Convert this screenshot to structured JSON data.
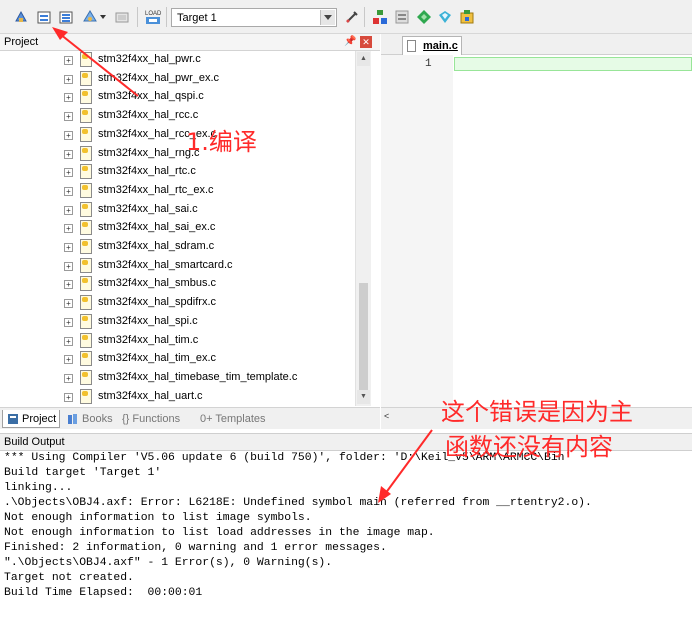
{
  "toolbar": {
    "target_value": "Target 1",
    "icons": [
      "translate-icon",
      "build-icon",
      "rebuild-icon",
      "batch-build-icon",
      "stop-build-icon",
      "download-icon",
      "target-options-icon",
      "manage-components-icon",
      "file-extensions-icon",
      "pack-installer-icon",
      "select-packs-icon"
    ]
  },
  "project_panel": {
    "title": "Project",
    "files": [
      "stm32f4xx_hal_pwr.c",
      "stm32f4xx_hal_pwr_ex.c",
      "stm32f4xx_hal_qspi.c",
      "stm32f4xx_hal_rcc.c",
      "stm32f4xx_hal_rcc_ex.c",
      "stm32f4xx_hal_rng.c",
      "stm32f4xx_hal_rtc.c",
      "stm32f4xx_hal_rtc_ex.c",
      "stm32f4xx_hal_sai.c",
      "stm32f4xx_hal_sai_ex.c",
      "stm32f4xx_hal_sdram.c",
      "stm32f4xx_hal_smartcard.c",
      "stm32f4xx_hal_smbus.c",
      "stm32f4xx_hal_spdifrx.c",
      "stm32f4xx_hal_spi.c",
      "stm32f4xx_hal_tim.c",
      "stm32f4xx_hal_tim_ex.c",
      "stm32f4xx_hal_timebase_tim_template.c",
      "stm32f4xx_hal_uart.c"
    ],
    "tabs": [
      "Project",
      "Books",
      "{} Functions",
      "0+ Templates"
    ]
  },
  "editor": {
    "tab_label": "main.c",
    "line_number": "1"
  },
  "build_output": {
    "title": "Build Output",
    "lines": [
      "*** Using Compiler 'V5.06 update 6 (build 750)', folder: 'D:\\Keil_v5\\ARM\\ARMCC\\Bin'",
      "Build target 'Target 1'",
      "linking...",
      ".\\Objects\\OBJ4.axf: Error: L6218E: Undefined symbol main (referred from __rtentry2.o).",
      "Not enough information to list image symbols.",
      "Not enough information to list load addresses in the image map.",
      "Finished: 2 information, 0 warning and 1 error messages.",
      "\".\\Objects\\OBJ4.axf\" - 1 Error(s), 0 Warning(s).",
      "Target not created.",
      "Build Time Elapsed:  00:00:01"
    ]
  },
  "annotations": {
    "compile_label": "1.编译",
    "error_note_line1": "这个错误是因为主",
    "error_note_line2": "函数还没有内容",
    "color": "#ff2a2a"
  }
}
